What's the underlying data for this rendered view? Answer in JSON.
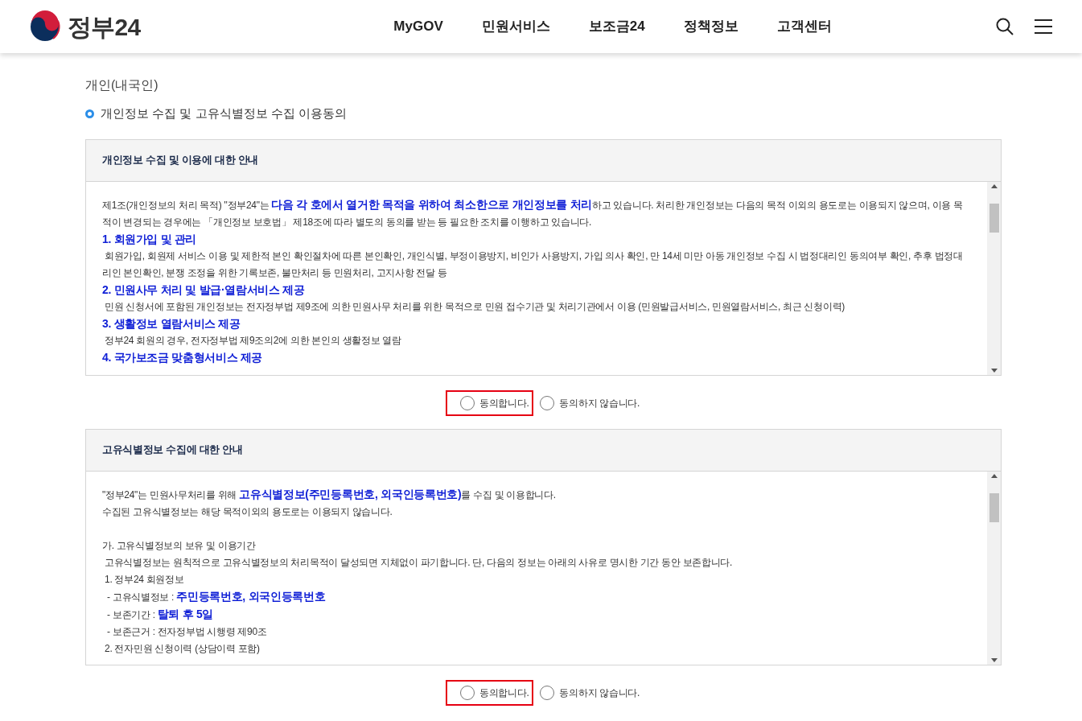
{
  "header": {
    "logo_text": "정부24",
    "nav": [
      {
        "label": "MyGOV"
      },
      {
        "label": "민원서비스"
      },
      {
        "label": "보조금24"
      },
      {
        "label": "정책정보"
      },
      {
        "label": "고객센터"
      }
    ]
  },
  "page_title": "개인(내국인)",
  "section_title": "개인정보 수집 및 고유식별정보 수집 이용동의",
  "agreements": [
    {
      "title": "개인정보 수집 및 이용에 대한 안내",
      "lines": [
        {
          "kind": "text",
          "text": "제1조(개인정보의 처리 목적) \"정부24\"는 **다음 각 호에서 열거한 목적을 위하여 최소한으로 개인정보를 처리**하고 있습니다. 처리한 개인정보는 다음의 목적 이외의 용도로는 이용되지 않으며, 이용 목적이 변경되는 경우에는 「개인정보 보호법」 제18조에 따라 별도의 동의를 받는 등 필요한 조치를 이행하고 있습니다."
        },
        {
          "kind": "heading",
          "text": "1. 회원가입 및 관리"
        },
        {
          "kind": "text",
          "text": " 회원가입, 회원제 서비스 이용 및 제한적 본인 확인절차에 따른 본인확인, 개인식별, 부정이용방지, 비인가 사용방지, 가입 의사 확인, 만 14세 미만 아동 개인정보 수집 시 법정대리인 동의여부 확인, 추후 법정대리인 본인확인, 분쟁 조정을 위한 기록보존, 불만처리 등 민원처리, 고지사항 전달 등"
        },
        {
          "kind": "heading",
          "text": "2. 민원사무 처리 및 발급·열람서비스 제공"
        },
        {
          "kind": "text",
          "text": " 민원 신청서에 포함된 개인정보는 전자정부법 제9조에 의한 민원사무 처리를 위한 목적으로 민원 접수기관 및 처리기관에서 이용 (민원발급서비스, 민원열람서비스, 최근 신청이력)"
        },
        {
          "kind": "heading",
          "text": "3. 생활정보 열람서비스 제공"
        },
        {
          "kind": "text",
          "text": " 정부24 회원의 경우, 전자정부법 제9조의2에 의한 본인의 생활정보 열람"
        },
        {
          "kind": "heading",
          "text": "4. 국가보조금 맞춤형서비스 제공"
        }
      ],
      "options": [
        {
          "label": "동의합니다.",
          "selected": false,
          "highlighted": true
        },
        {
          "label": "동의하지 않습니다.",
          "selected": false,
          "highlighted": false
        }
      ]
    },
    {
      "title": "고유식별정보 수집에 대한 안내",
      "lines": [
        {
          "kind": "text",
          "text": "\"정부24\"는 민원사무처리를 위해 **고유식별정보(주민등록번호, 외국인등록번호)**를 수집 및 이용합니다."
        },
        {
          "kind": "text",
          "text": "수집된 고유식별정보는 해당 목적이외의 용도로는 이용되지 않습니다."
        },
        {
          "kind": "blank"
        },
        {
          "kind": "text",
          "text": "가. 고유식별정보의 보유 및 이용기간"
        },
        {
          "kind": "text",
          "text": " 고유식별정보는 원칙적으로 고유식별정보의 처리목적이 달성되면 지체없이 파기합니다. 단, 다음의 정보는 아래의 사유로 명시한 기간 동안 보존합니다."
        },
        {
          "kind": "text",
          "text": " 1. 정부24 회원정보"
        },
        {
          "kind": "text",
          "text": "  - 고유식별정보 : **주민등록번호, 외국인등록번호**"
        },
        {
          "kind": "text",
          "text": "  - 보존기간 : **탈퇴 후 5일**"
        },
        {
          "kind": "text",
          "text": "  - 보존근거 : 전자정부법 시행령 제90조"
        },
        {
          "kind": "text",
          "text": " 2. 전자민원 신청이력 (상담이력 포함)"
        }
      ],
      "options": [
        {
          "label": "동의합니다.",
          "selected": false,
          "highlighted": true
        },
        {
          "label": "동의하지 않습니다.",
          "selected": false,
          "highlighted": false
        }
      ]
    }
  ]
}
